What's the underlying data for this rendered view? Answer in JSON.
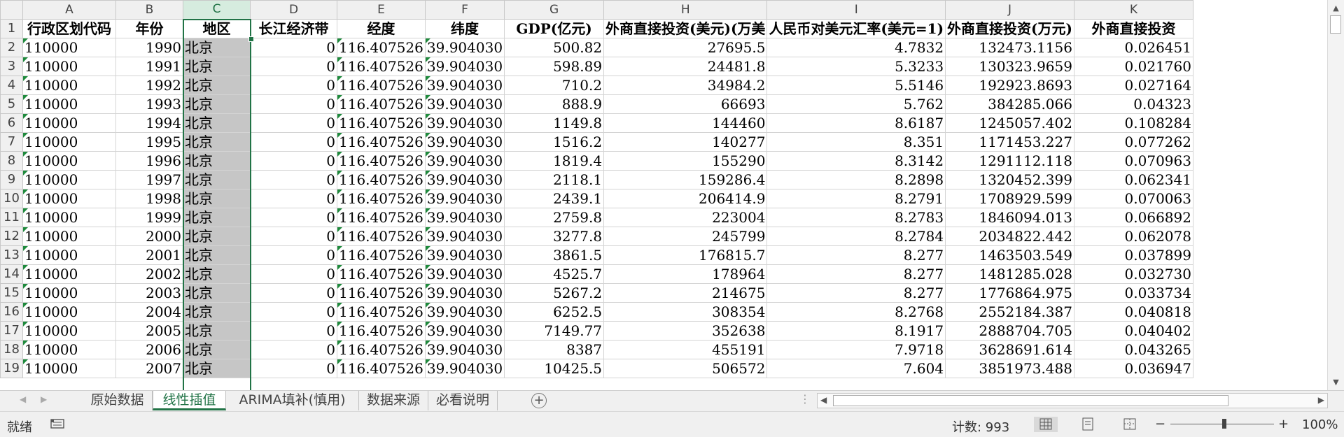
{
  "columns": [
    "A",
    "B",
    "C",
    "D",
    "E",
    "F",
    "G",
    "H",
    "I",
    "J",
    "K"
  ],
  "header_row": [
    "行政区划代码",
    "年份",
    "地区",
    "长江经济带",
    "经度",
    "纬度",
    "GDP(亿元)",
    "外商直接投资(美元)(万美",
    "人民币对美元汇率(美元=1)",
    "外商直接投资(万元)",
    "外商直接投资"
  ],
  "rows": [
    {
      "num": "2",
      "cells": [
        "110000",
        "1990",
        "北京",
        "0",
        "116.407526",
        "39.904030",
        "500.82",
        "27695.5",
        "4.7832",
        "132473.1156",
        "0.026451"
      ]
    },
    {
      "num": "3",
      "cells": [
        "110000",
        "1991",
        "北京",
        "0",
        "116.407526",
        "39.904030",
        "598.89",
        "24481.8",
        "5.3233",
        "130323.9659",
        "0.021760"
      ]
    },
    {
      "num": "4",
      "cells": [
        "110000",
        "1992",
        "北京",
        "0",
        "116.407526",
        "39.904030",
        "710.2",
        "34984.2",
        "5.5146",
        "192923.8693",
        "0.027164"
      ]
    },
    {
      "num": "5",
      "cells": [
        "110000",
        "1993",
        "北京",
        "0",
        "116.407526",
        "39.904030",
        "888.9",
        "66693",
        "5.762",
        "384285.066",
        "0.04323"
      ]
    },
    {
      "num": "6",
      "cells": [
        "110000",
        "1994",
        "北京",
        "0",
        "116.407526",
        "39.904030",
        "1149.8",
        "144460",
        "8.6187",
        "1245057.402",
        "0.108284"
      ]
    },
    {
      "num": "7",
      "cells": [
        "110000",
        "1995",
        "北京",
        "0",
        "116.407526",
        "39.904030",
        "1516.2",
        "140277",
        "8.351",
        "1171453.227",
        "0.077262"
      ]
    },
    {
      "num": "8",
      "cells": [
        "110000",
        "1996",
        "北京",
        "0",
        "116.407526",
        "39.904030",
        "1819.4",
        "155290",
        "8.3142",
        "1291112.118",
        "0.070963"
      ]
    },
    {
      "num": "9",
      "cells": [
        "110000",
        "1997",
        "北京",
        "0",
        "116.407526",
        "39.904030",
        "2118.1",
        "159286.4",
        "8.2898",
        "1320452.399",
        "0.062341"
      ]
    },
    {
      "num": "10",
      "cells": [
        "110000",
        "1998",
        "北京",
        "0",
        "116.407526",
        "39.904030",
        "2439.1",
        "206414.9",
        "8.2791",
        "1708929.599",
        "0.070063"
      ]
    },
    {
      "num": "11",
      "cells": [
        "110000",
        "1999",
        "北京",
        "0",
        "116.407526",
        "39.904030",
        "2759.8",
        "223004",
        "8.2783",
        "1846094.013",
        "0.066892"
      ]
    },
    {
      "num": "12",
      "cells": [
        "110000",
        "2000",
        "北京",
        "0",
        "116.407526",
        "39.904030",
        "3277.8",
        "245799",
        "8.2784",
        "2034822.442",
        "0.062078"
      ]
    },
    {
      "num": "13",
      "cells": [
        "110000",
        "2001",
        "北京",
        "0",
        "116.407526",
        "39.904030",
        "3861.5",
        "176815.7",
        "8.277",
        "1463503.549",
        "0.037899"
      ]
    },
    {
      "num": "14",
      "cells": [
        "110000",
        "2002",
        "北京",
        "0",
        "116.407526",
        "39.904030",
        "4525.7",
        "178964",
        "8.277",
        "1481285.028",
        "0.032730"
      ]
    },
    {
      "num": "15",
      "cells": [
        "110000",
        "2003",
        "北京",
        "0",
        "116.407526",
        "39.904030",
        "5267.2",
        "214675",
        "8.277",
        "1776864.975",
        "0.033734"
      ]
    },
    {
      "num": "16",
      "cells": [
        "110000",
        "2004",
        "北京",
        "0",
        "116.407526",
        "39.904030",
        "6252.5",
        "308354",
        "8.2768",
        "2552184.387",
        "0.040818"
      ]
    },
    {
      "num": "17",
      "cells": [
        "110000",
        "2005",
        "北京",
        "0",
        "116.407526",
        "39.904030",
        "7149.77",
        "352638",
        "8.1917",
        "2888704.705",
        "0.040402"
      ]
    },
    {
      "num": "18",
      "cells": [
        "110000",
        "2006",
        "北京",
        "0",
        "116.407526",
        "39.904030",
        "8387",
        "455191",
        "7.9718",
        "3628691.614",
        "0.043265"
      ]
    },
    {
      "num": "19",
      "cells": [
        "110000",
        "2007",
        "北京",
        "0",
        "116.407526",
        "39.904030",
        "10425.5",
        "506572",
        "7.604",
        "3851973.488",
        "0.036947"
      ]
    }
  ],
  "sheet_tabs": [
    "原始数据",
    "线性插值",
    "ARIMA填补(慎用)",
    "数据来源",
    "必看说明"
  ],
  "active_tab": "线性插值",
  "add_sheet": "+",
  "status": {
    "ready": "就绪",
    "count": "计数: 993",
    "zoom_minus": "−",
    "zoom_plus": "+",
    "zoom": "100%"
  },
  "icons": {
    "scroll_up": "up-arrow-icon",
    "scroll_down": "down-arrow-icon",
    "scroll_left": "left-arrow-icon",
    "scroll_right": "right-arrow-icon",
    "macro": "macro-record-icon",
    "normal_view": "normal-view-icon",
    "page_layout": "page-layout-icon",
    "page_break": "page-break-preview-icon"
  },
  "colors": {
    "accent": "#217346",
    "selection_fill": "#c6c6c6",
    "flag": "#1e8a3c"
  }
}
